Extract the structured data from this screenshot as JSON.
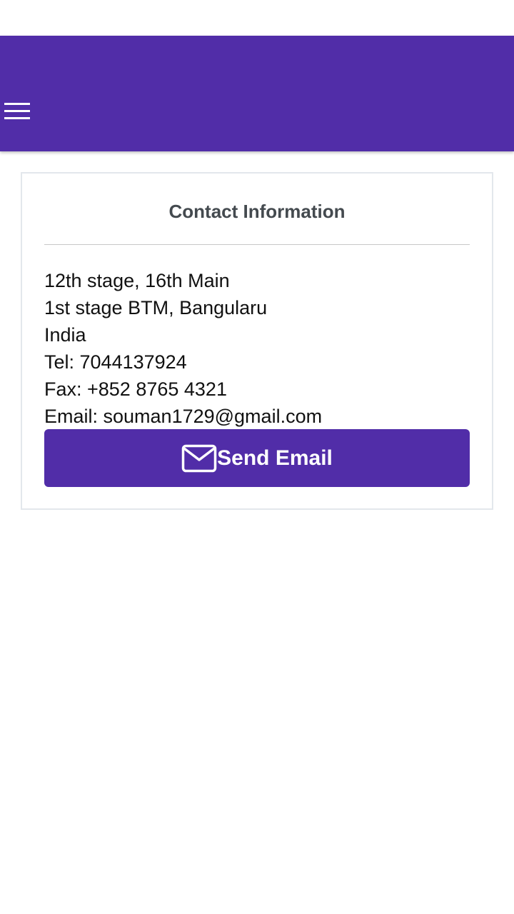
{
  "app_bar": {
    "color": "#512da8",
    "menu_icon": "hamburger-menu-icon"
  },
  "card": {
    "title": "Contact Information",
    "address_lines": [
      "12th stage, 16th Main",
      "1st stage BTM, Bangularu",
      "India"
    ],
    "tel": "Tel: 7044137924",
    "fax": "Fax: +852 8765 4321",
    "email": "Email: souman1729@gmail.com",
    "send_button": {
      "label": "Send Email",
      "icon": "envelope-icon",
      "color": "#512da8"
    }
  }
}
